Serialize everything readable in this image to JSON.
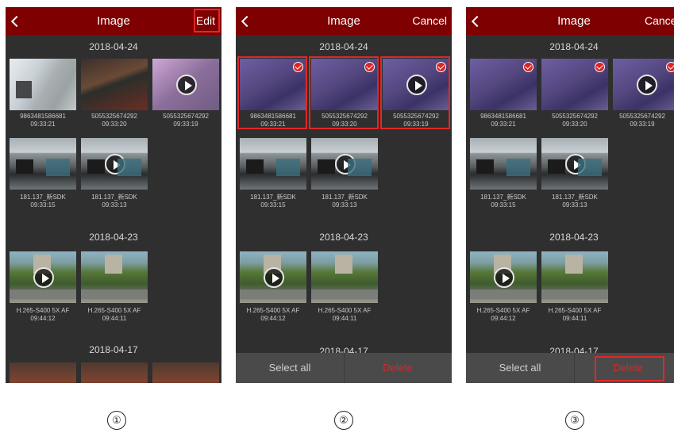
{
  "panels": [
    {
      "title": "Image",
      "action": "Edit",
      "date_sections": [
        "2018-04-24",
        "2018-04-23",
        "2018-04-17"
      ],
      "items": [
        {
          "name": "9863481586681",
          "time": "09:33:21",
          "kind": "image"
        },
        {
          "name": "5055325674292",
          "time": "09:33:20",
          "kind": "image"
        },
        {
          "name": "5055325674292",
          "time": "09:33:19",
          "kind": "video"
        },
        {
          "name": "181.137_新SDK",
          "time": "09:33:15",
          "kind": "image"
        },
        {
          "name": "181.137_新SDK",
          "time": "09:33:13",
          "kind": "video"
        },
        {
          "name": "H.265-S400 5X AF",
          "time": "09:44:12",
          "kind": "video"
        },
        {
          "name": "H.265-S400 5X AF",
          "time": "09:44:11",
          "kind": "image"
        }
      ]
    },
    {
      "title": "Image",
      "action": "Cancel",
      "date_sections": [
        "2018-04-24",
        "2018-04-23",
        "2018-04-17"
      ],
      "items": [
        {
          "name": "9863481586681",
          "time": "09:33:21",
          "kind": "image",
          "selected": true
        },
        {
          "name": "5055325674292",
          "time": "09:33:20",
          "kind": "image",
          "selected": true
        },
        {
          "name": "5055325674292",
          "time": "09:33:19",
          "kind": "video",
          "selected": true
        },
        {
          "name": "181.137_新SDK",
          "time": "09:33:15",
          "kind": "image",
          "selected": false
        },
        {
          "name": "181.137_新SDK",
          "time": "09:33:13",
          "kind": "video",
          "selected": false
        },
        {
          "name": "H.265-S400 5X AF",
          "time": "09:44:12",
          "kind": "video",
          "selected": false
        },
        {
          "name": "H.265-S400 5X AF",
          "time": "09:44:11",
          "kind": "image",
          "selected": false
        }
      ],
      "footer": {
        "select_all": "Select all",
        "delete": "Delete"
      }
    },
    {
      "title": "Image",
      "action": "Cance",
      "date_sections": [
        "2018-04-24",
        "2018-04-23",
        "2018-04-17"
      ],
      "items": [
        {
          "name": "9863481586681",
          "time": "09:33:21",
          "kind": "image",
          "selected": true
        },
        {
          "name": "5055325674292",
          "time": "09:33:20",
          "kind": "image",
          "selected": true
        },
        {
          "name": "5055325674292",
          "time": "09:33:19",
          "kind": "video",
          "selected": true
        },
        {
          "name": "181.137_新SDK",
          "time": "09:33:15",
          "kind": "image",
          "selected": false
        },
        {
          "name": "181.137_新SDK",
          "time": "09:33:13",
          "kind": "video",
          "selected": false
        },
        {
          "name": "H.265-S400 5X AF",
          "time": "09:44:12",
          "kind": "video",
          "selected": false
        },
        {
          "name": "H.265-S400 5X AF",
          "time": "09:44:11",
          "kind": "image",
          "selected": false
        }
      ],
      "footer": {
        "select_all": "Select all",
        "delete": "Delete"
      }
    }
  ],
  "steps": [
    "①",
    "②",
    "③"
  ],
  "colors": {
    "header": "#7e0000",
    "background": "#2f2f2f",
    "highlight": "#e12828",
    "delete": "#d42a2a"
  }
}
